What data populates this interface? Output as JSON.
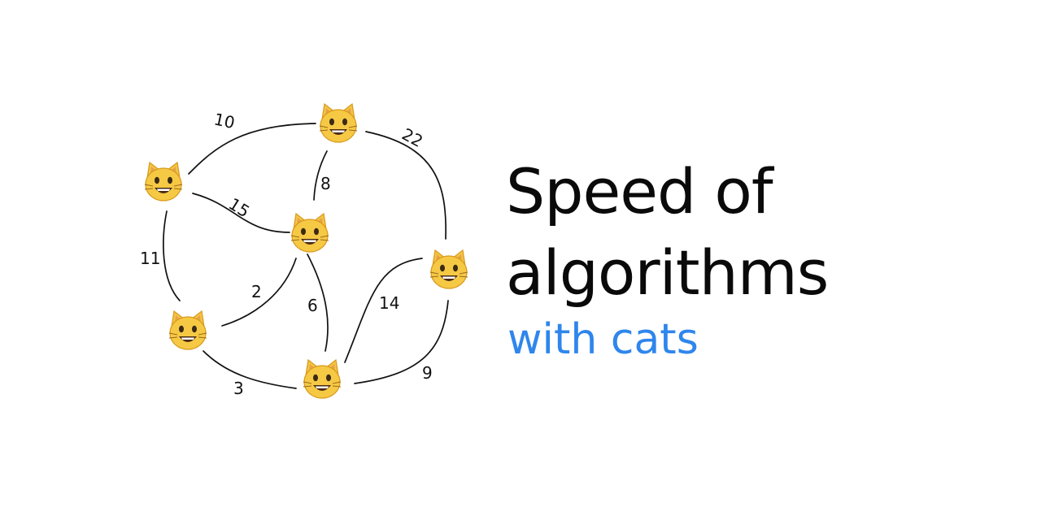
{
  "diagram": {
    "nodes": [
      {
        "id": "n1",
        "icon": "smiling-cat-face-icon"
      },
      {
        "id": "n2",
        "icon": "smiling-cat-face-icon"
      },
      {
        "id": "n3",
        "icon": "smiling-cat-face-icon"
      },
      {
        "id": "n4",
        "icon": "smiling-cat-face-icon"
      },
      {
        "id": "n5",
        "icon": "smiling-cat-face-icon"
      },
      {
        "id": "n6",
        "icon": "smiling-cat-face-icon"
      }
    ],
    "edges": [
      {
        "from": "n1",
        "to": "n2",
        "weight": "10"
      },
      {
        "from": "n2",
        "to": "n5",
        "weight": "22"
      },
      {
        "from": "n2",
        "to": "n3",
        "weight": "8"
      },
      {
        "from": "n1",
        "to": "n3",
        "weight": "15"
      },
      {
        "from": "n1",
        "to": "n4",
        "weight": "11"
      },
      {
        "from": "n3",
        "to": "n4",
        "weight": "2"
      },
      {
        "from": "n3",
        "to": "n6",
        "weight": "6"
      },
      {
        "from": "n5",
        "to": "n6",
        "weight": "14"
      },
      {
        "from": "n4",
        "to": "n6",
        "weight": "3"
      },
      {
        "from": "n6",
        "to": "n5",
        "weight": "9"
      }
    ],
    "node_color": "#f4c542",
    "edge_color": "#111111"
  },
  "heading": {
    "line1": "Speed of",
    "line2": "algorithms",
    "color": "#0a0a0a"
  },
  "subheading": {
    "text": "with cats",
    "color": "#2f86ec"
  }
}
